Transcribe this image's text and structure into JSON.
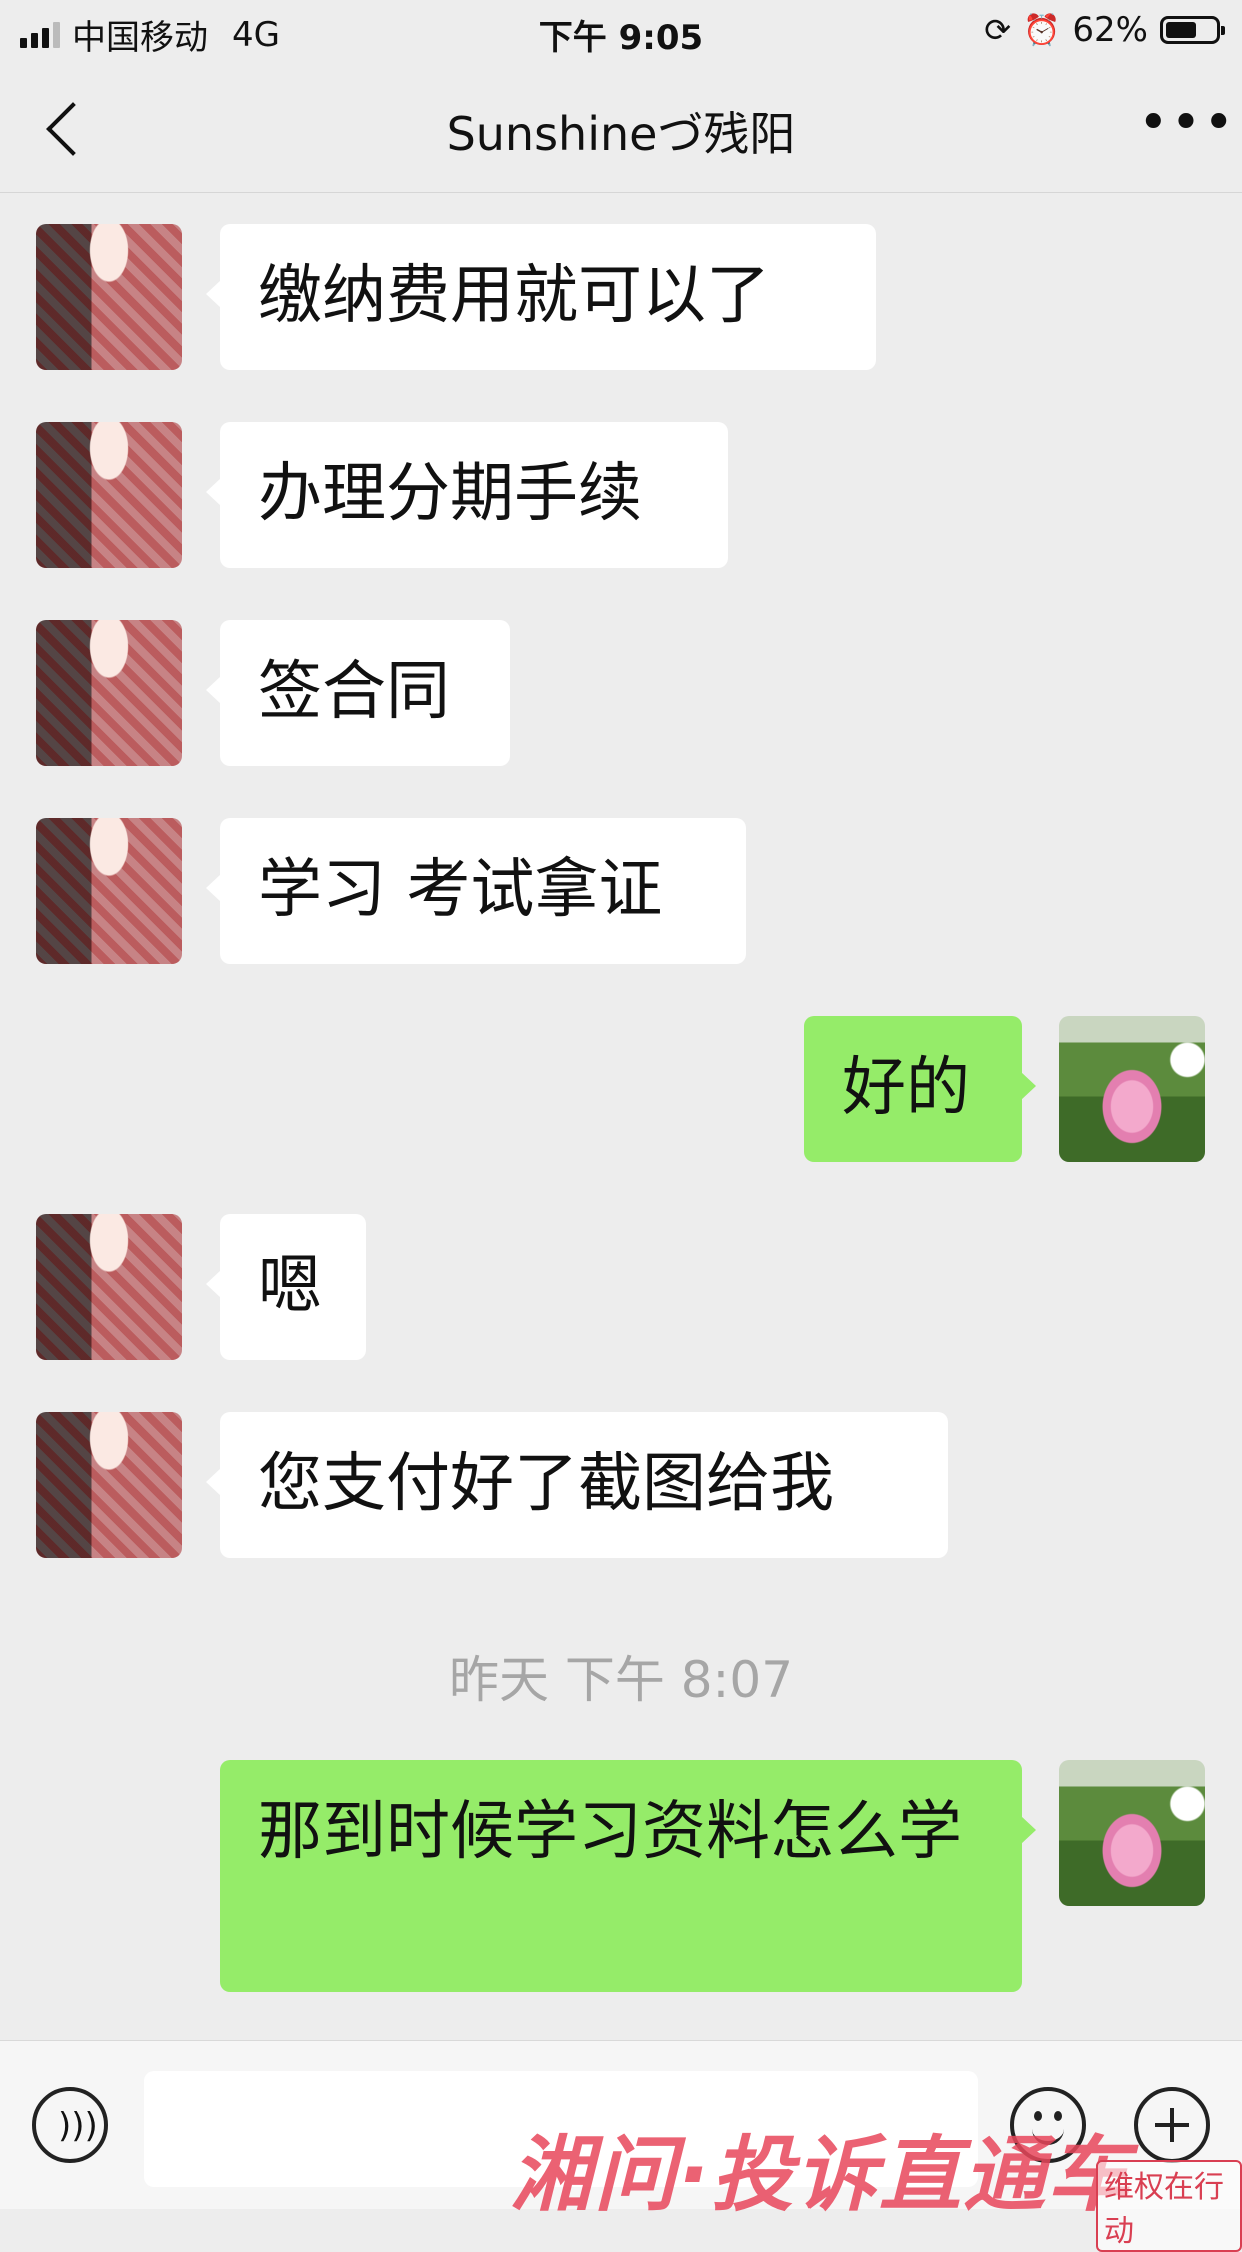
{
  "status_bar": {
    "carrier": "中国移动",
    "network": "4G",
    "time": "下午 9:05",
    "battery": "62%",
    "battery_level": 0.62
  },
  "nav": {
    "back_icon": "chevron-left-icon",
    "title": "Sunshineづ残阳",
    "more": "•••"
  },
  "messages": [
    {
      "side": "in",
      "text": "缴纳费用就可以了"
    },
    {
      "side": "in",
      "text": "办理分期手续"
    },
    {
      "side": "in",
      "text": "签合同"
    },
    {
      "side": "in",
      "text": "学习 考试拿证"
    },
    {
      "side": "out",
      "text": "好的"
    },
    {
      "side": "in",
      "text": "嗯"
    },
    {
      "side": "in",
      "text": "您支付好了截图给我"
    },
    {
      "side": "out",
      "text": "那到时候学习资料怎么学"
    }
  ],
  "timestamp": "昨天 下午 8:07",
  "watermark": {
    "main": "湘问·投诉直通车",
    "small": "维权在行动"
  }
}
